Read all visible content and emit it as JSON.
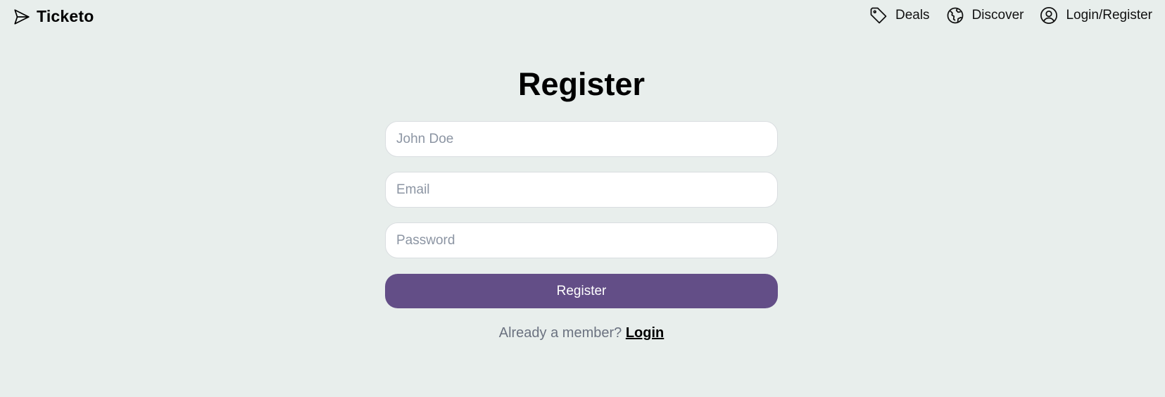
{
  "brand": {
    "name": "Ticketo",
    "icon": "paper-plane-icon"
  },
  "nav": {
    "items": [
      {
        "label": "Deals",
        "icon": "tag-icon"
      },
      {
        "label": "Discover",
        "icon": "globe-icon"
      },
      {
        "label": "Login/Register",
        "icon": "user-circle-icon"
      }
    ]
  },
  "form": {
    "title": "Register",
    "name_placeholder": "John Doe",
    "email_placeholder": "Email",
    "password_placeholder": "Password",
    "submit_label": "Register",
    "member_text": "Already a member?",
    "login_link": "Login"
  },
  "colors": {
    "background": "#e8eeec",
    "accent": "#634e87"
  }
}
